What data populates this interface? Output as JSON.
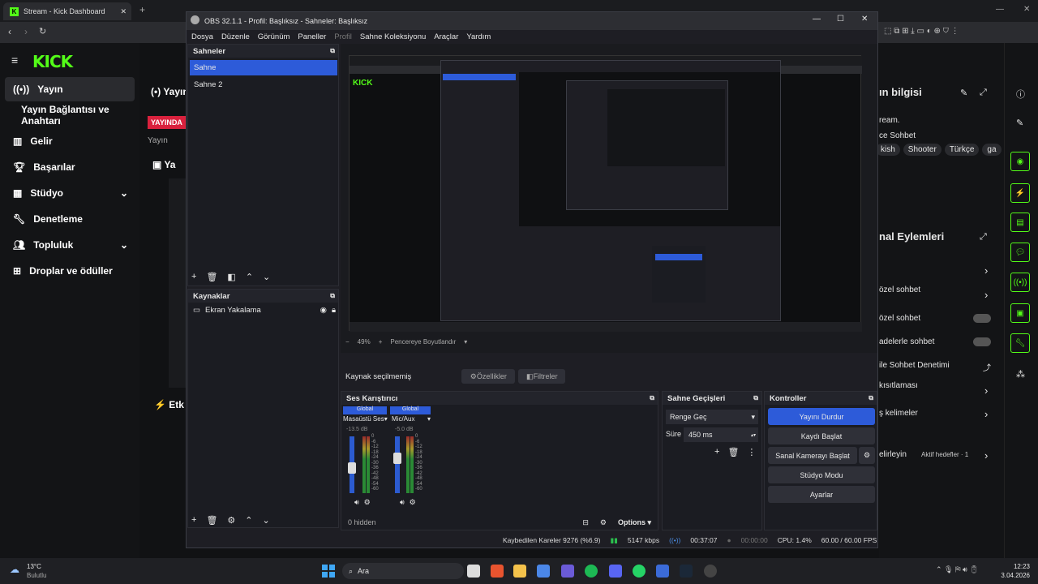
{
  "browser": {
    "tab_title": "Stream - Kick Dashboard",
    "new_tab": "+"
  },
  "kick": {
    "logo": "KICK",
    "nav": [
      "Yayın",
      "Yayın Bağlantısı ve Anahtarı",
      "Gelir",
      "Başarılar",
      "Stüdyo",
      "Denetleme",
      "Topluluk",
      "Droplar ve ödüller"
    ],
    "live_badge": "YAYINDA",
    "yayin_label": "Yayın",
    "section_yayin": "Yayın",
    "etkinlik": "Etk",
    "right": {
      "title": "ın bilgisi",
      "stream": "ream.",
      "category": "ce Sohbet",
      "tags": [
        "kish",
        "Shooter",
        "Türkçe",
        "ga"
      ],
      "actions_title": "nal Eylemleri",
      "ozel1": "özel sohbet",
      "ozel2": "özel sohbet",
      "adelerle": "adelerle sohbet",
      "ile_sohbet": "ile Sohbet Denetimi",
      "kisitlamasi": "kısıtlaması",
      "kelimeler": "ş kelimeler",
      "belirleyin": "elirleyin",
      "aktif": "Aktif hedefler · 1"
    }
  },
  "obs": {
    "title": "OBS 32.1.1 - Profil: Başlıksız - Sahneler: Başlıksız",
    "menu": [
      "Dosya",
      "Düzenle",
      "Görünüm",
      "Paneller",
      "Profil",
      "Sahne Koleksiyonu",
      "Araçlar",
      "Yardım"
    ],
    "scenes_title": "Sahneler",
    "scenes": [
      "Sahne",
      "Sahne 2"
    ],
    "sources_title": "Kaynaklar",
    "sources": [
      "Ekran Yakalama"
    ],
    "zoom": "49%",
    "fit": "Pencereye Boyutlandır",
    "no_source": "Kaynak seçilmemiş",
    "props": "Özellikler",
    "filters": "Filtreler",
    "mixer_title": "Ses Karıştırıcı",
    "mixer": [
      {
        "tag": "Global",
        "name": "Masaüstü Ses",
        "db": "-13.5 dB",
        "level": 0.45
      },
      {
        "tag": "Global",
        "name": "Mic/Aux",
        "db": "-5.0 dB",
        "level": 0.62
      }
    ],
    "scale": [
      "0",
      "-6",
      "-12",
      "-18",
      "-24",
      "-30",
      "-36",
      "-42",
      "-48",
      "-54",
      "-60"
    ],
    "hidden": "0 hidden",
    "options": "Options",
    "transitions_title": "Sahne Geçişleri",
    "transition": "Renge Geç",
    "duration_label": "Süre",
    "duration": "450 ms",
    "controls_title": "Kontroller",
    "controls": [
      "Yayını Durdur",
      "Kaydı Başlat",
      "Sanal Kamerayı Başlat",
      "Stüdyo Modu",
      "Ayarlar"
    ],
    "status": {
      "dropped": "Kaybedilen Kareler 9276 (%6.9)",
      "kbps": "5147 kbps",
      "stream_time": "00:37:07",
      "rec_time": "00:00:00",
      "cpu": "CPU: 1.4%",
      "fps": "60.00 / 60.00 FPS"
    }
  },
  "taskbar": {
    "weather_temp": "13°C",
    "weather_desc": "Bulutlu",
    "search": "Ara",
    "time": "12:23",
    "date": "3.04.2026"
  },
  "colors": {
    "kick_green": "#53fc18",
    "obs_blue": "#2d5bd9",
    "live_red": "#d9213d"
  }
}
